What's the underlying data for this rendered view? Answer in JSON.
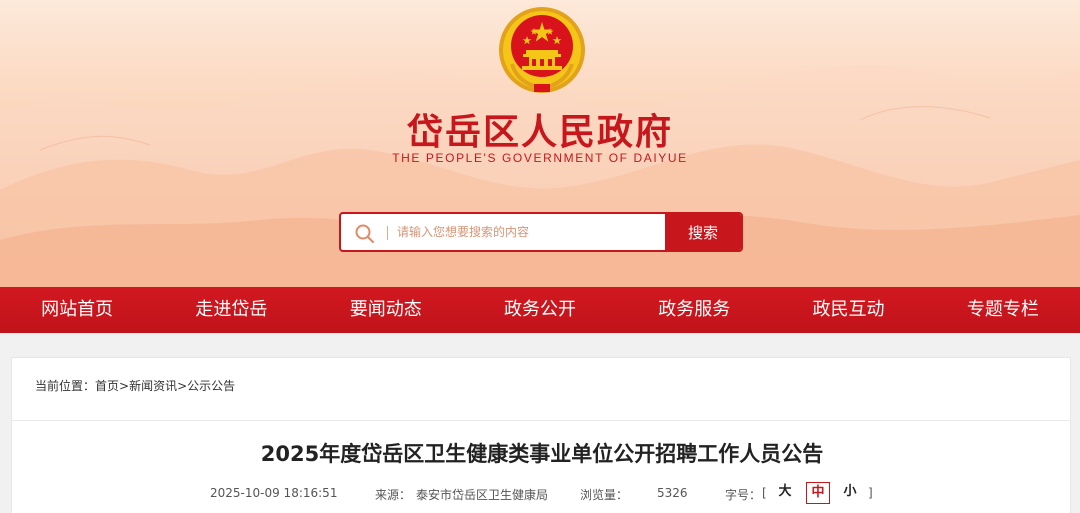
{
  "header": {
    "site_title": "岱岳区人民政府",
    "site_subtitle": "THE PEOPLE'S GOVERNMENT OF DAIYUE"
  },
  "search": {
    "placeholder": "请输入您想要搜索的内容",
    "button_label": "搜索"
  },
  "nav": {
    "items": [
      {
        "label": "网站首页"
      },
      {
        "label": "走进岱岳"
      },
      {
        "label": "要闻动态"
      },
      {
        "label": "政务公开"
      },
      {
        "label": "政务服务"
      },
      {
        "label": "政民互动"
      },
      {
        "label": "专题专栏"
      }
    ]
  },
  "breadcrumb": {
    "prefix": "当前位置：",
    "items": [
      "首页",
      "新闻资讯",
      "公示公告"
    ],
    "separator": ">"
  },
  "article": {
    "title": "2025年度岱岳区卫生健康类事业单位公开招聘工作人员公告",
    "date": "2025-10-09 18:16:51",
    "source_label": "来源：",
    "source": "泰安市岱岳区卫生健康局",
    "views_label": "浏览量：",
    "views": "5326",
    "font_size_label": "字号：",
    "bracket_open": "[",
    "bracket_close": "]",
    "font_sizes": [
      "大",
      "中",
      "小"
    ],
    "active_font_size": "中"
  },
  "colors": {
    "brand_red": "#c8161d",
    "banner_peach": "#f8c3a4",
    "emblem_gold": "#f5c518"
  }
}
